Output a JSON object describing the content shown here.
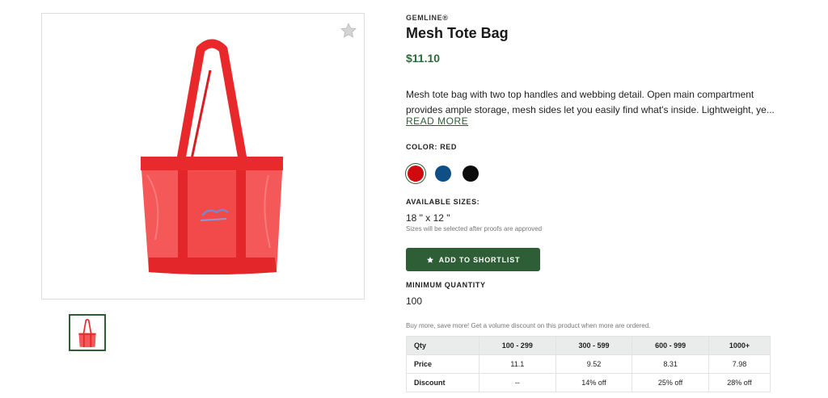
{
  "product": {
    "brand": "GEMLINE®",
    "title": "Mesh Tote Bag",
    "price": "$11.10",
    "description_lines": [
      "Mesh tote bag with two top handles and webbing detail. Open main compartment",
      "provides ample storage, mesh sides let you easily find what's inside. Lightweight, ye..."
    ],
    "read_more": "READ MORE",
    "color_label": "COLOR: RED",
    "colors": [
      {
        "name": "red",
        "hex": "#d10a10",
        "selected": true
      },
      {
        "name": "blue",
        "hex": "#0e4f86",
        "selected": false
      },
      {
        "name": "black",
        "hex": "#0c0c0c",
        "selected": false
      }
    ],
    "sizes_label": "AVAILABLE SIZES:",
    "size_value": "18 \" x 12 \"",
    "size_note": "Sizes will be selected after proofs are approved",
    "add_button": "ADD TO SHORTLIST",
    "min_qty_label": "MINIMUM QUANTITY",
    "min_qty_value": "100",
    "bulk_note": "Buy more, save more! Get a volume discount on this product when more are ordered."
  },
  "pricing_table": {
    "headers": [
      "Qty",
      "100 - 299",
      "300 - 599",
      "600 - 999",
      "1000+"
    ],
    "rows": [
      [
        "Price",
        "11.1",
        "9.52",
        "8.31",
        "7.98"
      ],
      [
        "Discount",
        "--",
        "14% off",
        "25% off",
        "28% off"
      ]
    ]
  },
  "icons": {
    "favorite": "star-icon",
    "button": "star-icon"
  },
  "colors": {
    "accent": "#2e5e36",
    "price": "#2e6b3a",
    "bag_red": "#f23a3a"
  }
}
